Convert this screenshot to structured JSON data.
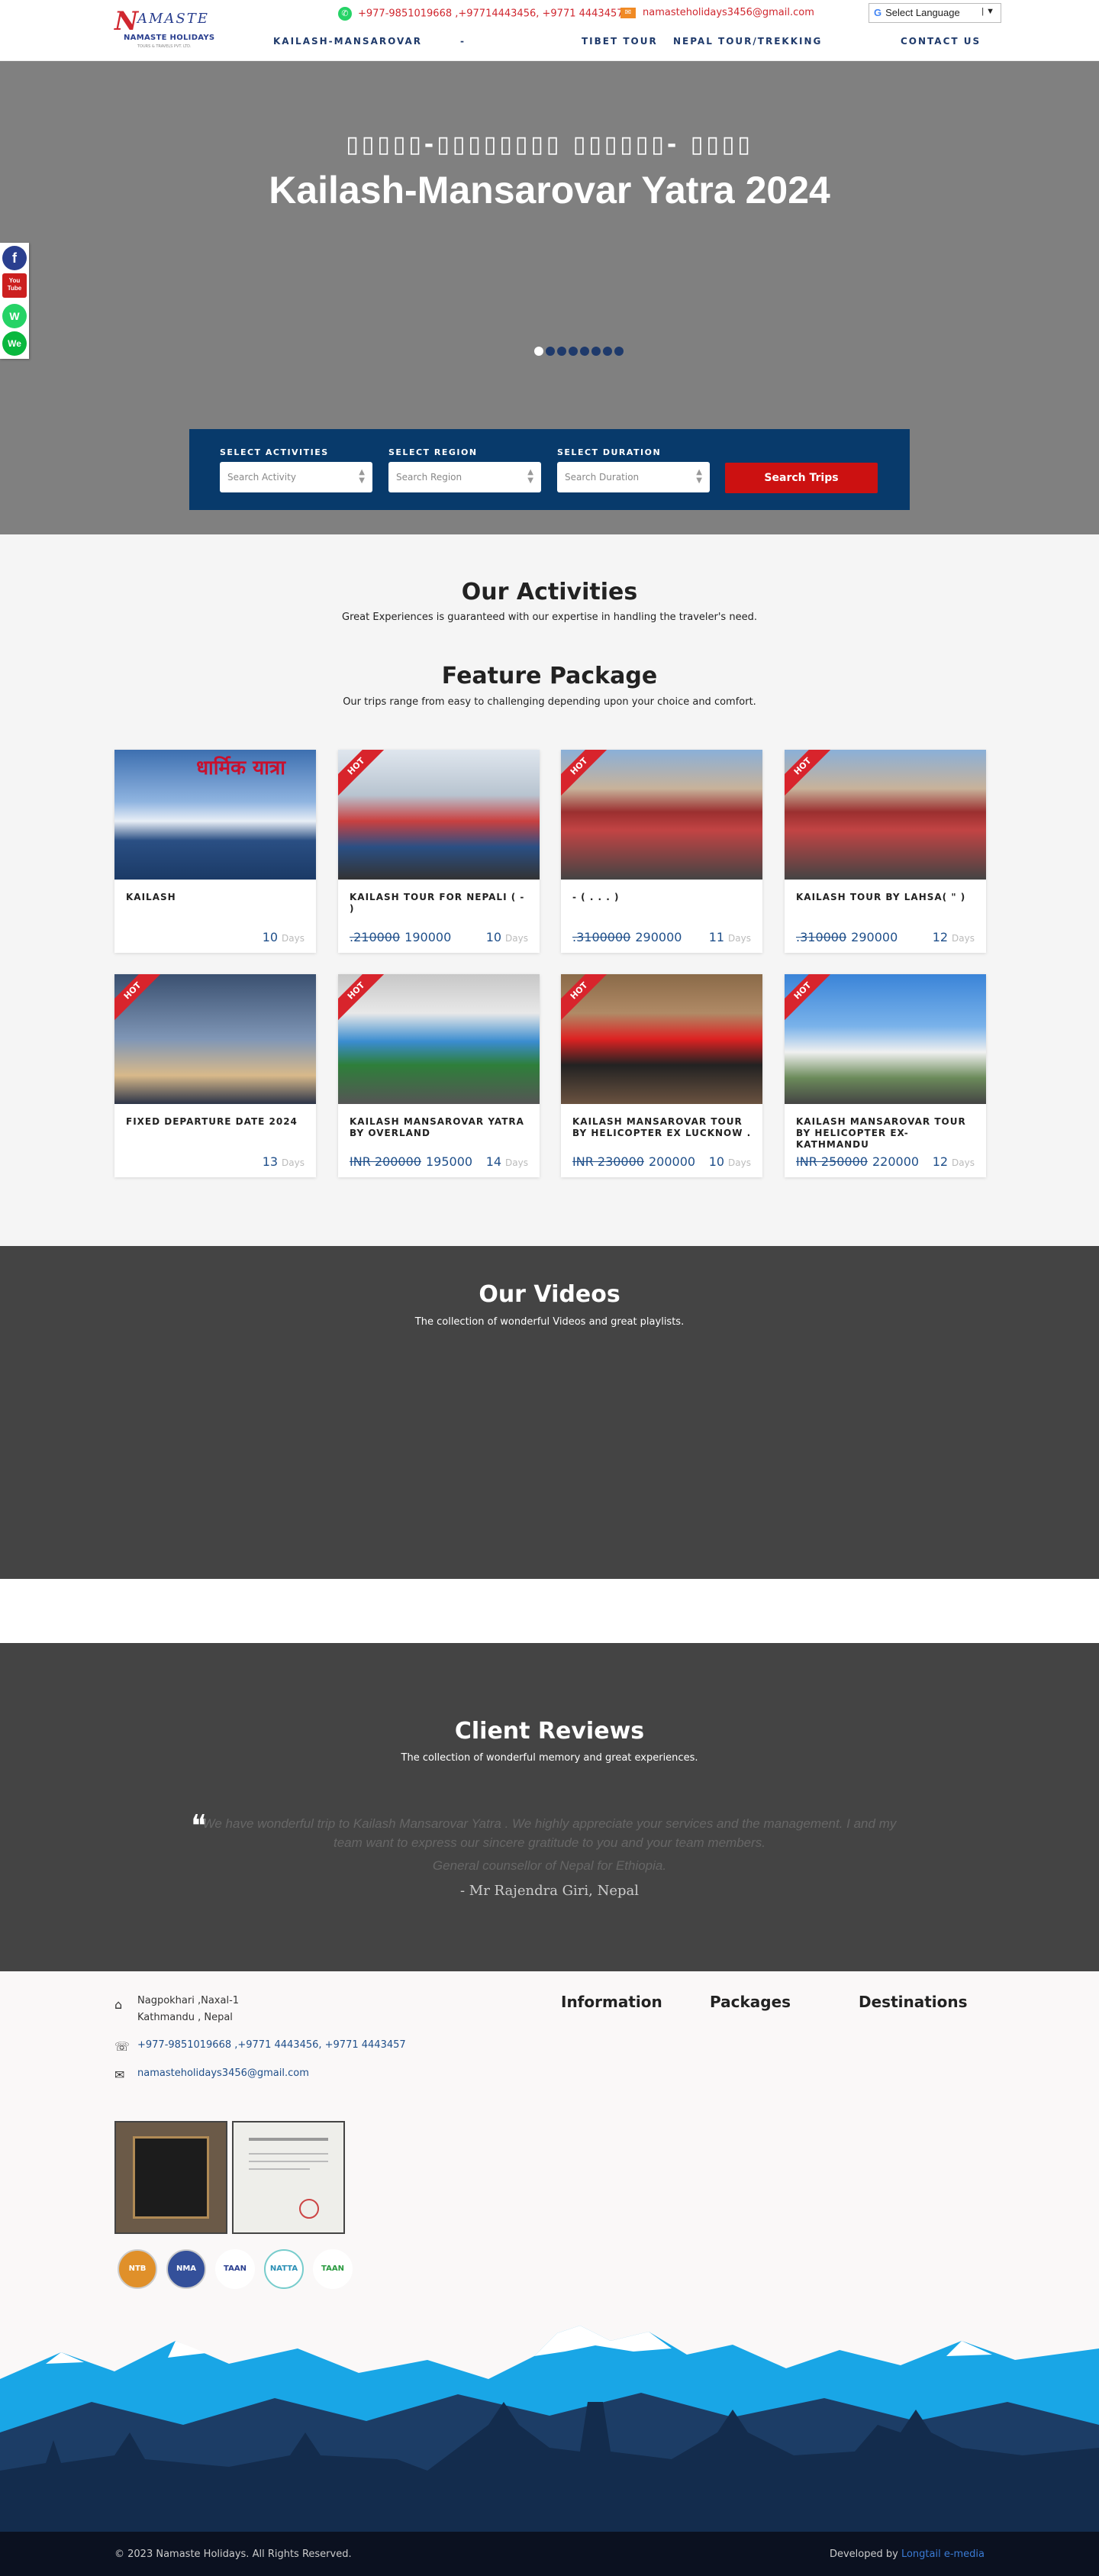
{
  "header": {
    "logo_mark": "N",
    "logo_word": "AMASTE",
    "logo_brand": "NAMASTE HOLIDAYS",
    "logo_tagline": "TOURS & TRAVELS PVT. LTD.",
    "phone": "+977-9851019668 ,+97714443456, +9771 4443457",
    "email": "namasteholidays3456@gmail.com",
    "language_label": "Select Language",
    "nav": [
      "KAILASH-MANSAROVAR",
      "-",
      "TIBET TOUR",
      "NEPAL TOUR/TREKKING",
      "CONTACT US"
    ]
  },
  "social": [
    "f",
    "You Tube",
    "W",
    "We"
  ],
  "hero": {
    "subtitle": "▯▯▯▯▯-▯▯▯▯▯▯▯▯ ▯▯▯▯▯▯- ▯▯▯▯",
    "title": "Kailash-Mansarovar Yatra 2024",
    "slides": 8,
    "active_slide": 0
  },
  "search": {
    "activity_label": "SELECT ACTIVITIES",
    "activity_placeholder": "Search Activity",
    "region_label": "SELECT REGION",
    "region_placeholder": "Search Region",
    "duration_label": "SELECT DURATION",
    "duration_placeholder": "Search Duration",
    "button": "Search Trips"
  },
  "activities": {
    "title": "Our Activities",
    "subtitle": "Great Experiences is guaranteed with our expertise in handling the traveler's need."
  },
  "packages": {
    "title": "Feature Package",
    "subtitle": "Our trips range from easy to challenging depending upon your choice and comfort.",
    "hot_label": "HOT",
    "days_unit": "Days",
    "cards": [
      {
        "title": "KAILASH",
        "old_price": "",
        "price": "",
        "days": "10",
        "hot": false,
        "photo": "धार्मिक यात्रा"
      },
      {
        "title": "KAILASH TOUR FOR NEPALI ( - )",
        "old_price": ".210000",
        "price": "190000",
        "days": "10",
        "hot": true,
        "photo": ""
      },
      {
        "title": "- ( . . . )",
        "old_price": ".3100000",
        "price": "290000",
        "days": "11",
        "hot": true,
        "photo": ""
      },
      {
        "title": "KAILASH TOUR BY LAHSA( \" )",
        "old_price": ".310000",
        "price": "290000",
        "days": "12",
        "hot": true,
        "photo": ""
      },
      {
        "title": "FIXED DEPARTURE DATE 2024",
        "old_price": "",
        "price": "",
        "days": "13",
        "hot": true,
        "photo": ""
      },
      {
        "title": "KAILASH MANSAROVAR YATRA BY OVERLAND",
        "old_price": "INR 200000",
        "price": "195000",
        "days": "14",
        "hot": true,
        "photo": ""
      },
      {
        "title": "KAILASH MANSAROVAR TOUR BY HELICOPTER EX LUCKNOW .",
        "old_price": "INR 230000",
        "price": "200000",
        "days": "10",
        "hot": true,
        "photo": ""
      },
      {
        "title": "KAILASH MANSAROVAR TOUR BY HELICOPTER EX-KATHMANDU",
        "old_price": "INR 250000",
        "price": "220000",
        "days": "12",
        "hot": true,
        "photo": ""
      }
    ]
  },
  "videos": {
    "title": "Our Videos",
    "subtitle": "The collection of wonderful Videos and great playlists."
  },
  "reviews": {
    "title": "Client Reviews",
    "subtitle": "The collection of wonderful memory and great experiences.",
    "quote": "We have wonderful trip to Kailash Mansarovar Yatra . We highly appreciate your services and the management. I and my team want to express our sincere gratitude to you and your team members.",
    "role": "General counsellor of Nepal for Ethiopia.",
    "author": "- Mr Rajendra Giri, Nepal"
  },
  "footer": {
    "address_line1": "Nagpokhari ,Naxal-1",
    "address_line2": "Kathmandu , Nepal",
    "phone": "+977-9851019668 ,+9771 4443456, +9771 4443457",
    "email": "namasteholidays3456@gmail.com",
    "headings": [
      "Information",
      "Packages",
      "Destinations"
    ],
    "badges": [
      "NTB",
      "NMA",
      "TAAN",
      "NATTA",
      "TAAN"
    ],
    "copyright": "© 2023 Namaste Holidays. All Rights Reserved.",
    "developed_prefix": "Developed by",
    "developer": "Longtail e-media"
  },
  "colors": {
    "navy": "#083a6b",
    "accent_red": "#cc1111",
    "dark_section": "#444444"
  }
}
